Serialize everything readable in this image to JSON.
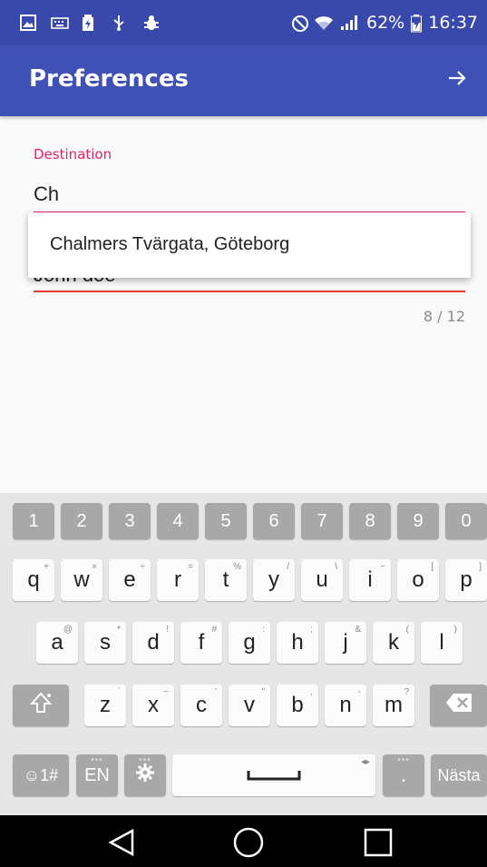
{
  "status": {
    "battery": "62%",
    "time": "16:37"
  },
  "appbar": {
    "title": "Preferences",
    "next_icon": "arrow-right-icon"
  },
  "form": {
    "destination": {
      "label": "Destination",
      "value": "Ch"
    },
    "name": {
      "value": "John doe"
    },
    "counter": "8 / 12"
  },
  "autocomplete": {
    "items": [
      "Chalmers Tvärgata, Göteborg"
    ]
  },
  "keyboard": {
    "numbers": [
      "1",
      "2",
      "3",
      "4",
      "5",
      "6",
      "7",
      "8",
      "9",
      "0"
    ],
    "row1": [
      {
        "k": "q",
        "h": "+"
      },
      {
        "k": "w",
        "h": "×"
      },
      {
        "k": "e",
        "h": "÷"
      },
      {
        "k": "r",
        "h": "="
      },
      {
        "k": "t",
        "h": "%"
      },
      {
        "k": "y",
        "h": "/"
      },
      {
        "k": "u",
        "h": "\\"
      },
      {
        "k": "i",
        "h": "~"
      },
      {
        "k": "o",
        "h": "["
      },
      {
        "k": "p",
        "h": "]"
      }
    ],
    "row2": [
      {
        "k": "a",
        "h": "@"
      },
      {
        "k": "s",
        "h": "*"
      },
      {
        "k": "d",
        "h": "!"
      },
      {
        "k": "f",
        "h": "#"
      },
      {
        "k": "g",
        "h": ":"
      },
      {
        "k": "h",
        "h": ";"
      },
      {
        "k": "j",
        "h": "&"
      },
      {
        "k": "k",
        "h": "("
      },
      {
        "k": "l",
        "h": ")"
      }
    ],
    "row3": [
      {
        "k": "z",
        "h": "`"
      },
      {
        "k": "x",
        "h": "−"
      },
      {
        "k": "c",
        "h": "'"
      },
      {
        "k": "v",
        "h": "\""
      },
      {
        "k": "b",
        "h": ","
      },
      {
        "k": "n",
        "h": "-"
      },
      {
        "k": "m",
        "h": "?"
      }
    ],
    "symbols_label": "☺1#",
    "lang_label": "EN",
    "period_label": ".",
    "action_label": "Nästa"
  },
  "colors": {
    "primary": "#3f51b5",
    "status_bar": "#3949ab",
    "accent": "#e91e63",
    "error": "#e53935"
  }
}
